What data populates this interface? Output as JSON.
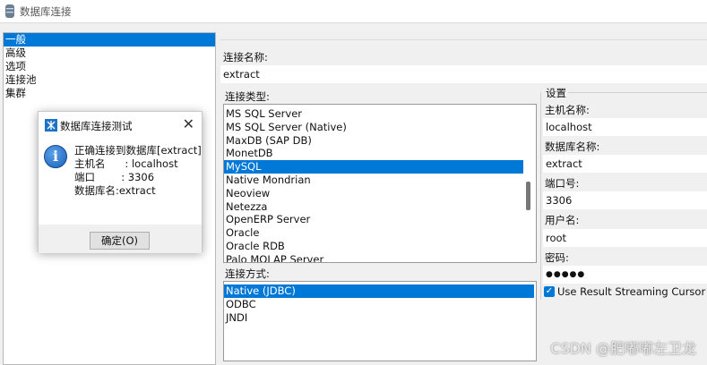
{
  "window": {
    "title": "数据库连接"
  },
  "nav": {
    "items": [
      {
        "label": "一般",
        "selected": true
      },
      {
        "label": "高级",
        "selected": false
      },
      {
        "label": "选项",
        "selected": false
      },
      {
        "label": "连接池",
        "selected": false
      },
      {
        "label": "集群",
        "selected": false
      }
    ]
  },
  "form": {
    "conn_name_label": "连接名称:",
    "conn_name_value": "extract",
    "conn_type_label": "连接类型:",
    "conn_types": [
      {
        "label": "MS SQL Server",
        "selected": false
      },
      {
        "label": "MS SQL Server (Native)",
        "selected": false
      },
      {
        "label": "MaxDB (SAP DB)",
        "selected": false
      },
      {
        "label": "MonetDB",
        "selected": false
      },
      {
        "label": "MySQL",
        "selected": true
      },
      {
        "label": "Native Mondrian",
        "selected": false
      },
      {
        "label": "Neoview",
        "selected": false
      },
      {
        "label": "Netezza",
        "selected": false
      },
      {
        "label": "OpenERP Server",
        "selected": false
      },
      {
        "label": "Oracle",
        "selected": false
      },
      {
        "label": "Oracle RDB",
        "selected": false
      },
      {
        "label": "Palo MOLAP Server",
        "selected": false
      }
    ],
    "access_label": "连接方式:",
    "access_methods": [
      {
        "label": "Native (JDBC)",
        "selected": true
      },
      {
        "label": "ODBC",
        "selected": false
      },
      {
        "label": "JNDI",
        "selected": false
      }
    ]
  },
  "settings": {
    "group_label": "设置",
    "host_label": "主机名称:",
    "host_value": "localhost",
    "db_label": "数据库名称:",
    "db_value": "extract",
    "port_label": "端口号:",
    "port_value": "3306",
    "user_label": "用户名:",
    "user_value": "root",
    "password_label": "密码:",
    "password_value": "●●●●●",
    "streaming_label": "Use Result Streaming Cursor",
    "streaming_checked": true
  },
  "dialog": {
    "title": "数据库连接测试",
    "lines": [
      "正确连接到数据库[extract]",
      "主机名      : localhost",
      "端口        : 3306",
      "数据库名:extract"
    ],
    "ok_label": "确定(O)"
  },
  "watermark": "CSDN @肥嘟嘟左卫龙",
  "colors": {
    "selection": "#0078d7",
    "info_icon": "#1c5fb5"
  },
  "icons": [
    "database-icon",
    "info-icon",
    "close-icon",
    "checkmark-icon",
    "kettle-icon"
  ]
}
